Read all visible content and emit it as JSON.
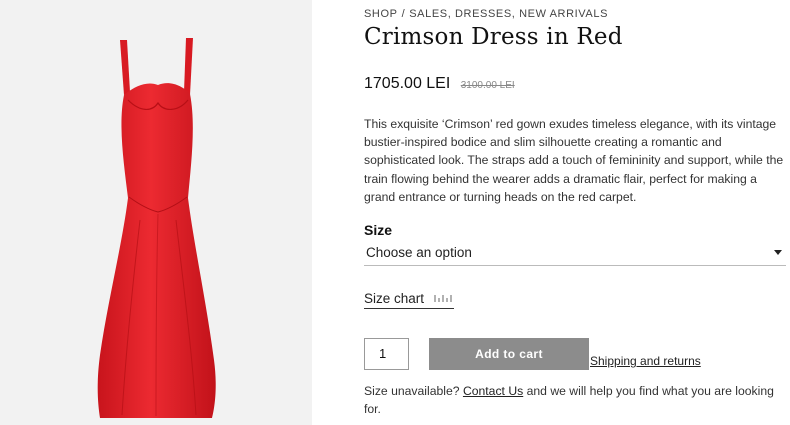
{
  "breadcrumb": {
    "root": "SHOP",
    "separator": "/",
    "items": "SALES, DRESSES, NEW ARRIVALS"
  },
  "product": {
    "title": "Crimson Dress in Red",
    "price_current": "1705.00 LEI",
    "price_old": "3100.00 LEI",
    "description": "This exquisite ‘Crimson’ red gown exudes timeless elegance, with its vintage bustier-inspired bodice and slim silhouette creating a romantic and sophisticated look. The straps add a touch of femininity and support, while the train flowing behind the wearer adds a dramatic flair, perfect for making a grand entrance or turning heads on the red carpet."
  },
  "size": {
    "label": "Size",
    "selected": "Choose an option",
    "chart_label": "Size chart"
  },
  "cart": {
    "quantity": "1",
    "add_label": "Add to cart",
    "shipping_link": "Shipping and returns"
  },
  "help": {
    "prefix": "Size unavailable?",
    "link": "Contact Us",
    "suffix": "and we will help you find what you are looking for."
  },
  "colors": {
    "dress": "#e31c25",
    "button": "#8c8c8c",
    "gallery_bg": "#f2f2f2"
  },
  "icons": {
    "size_chart": "ruler-icon",
    "dropdown": "chevron-down-icon"
  }
}
